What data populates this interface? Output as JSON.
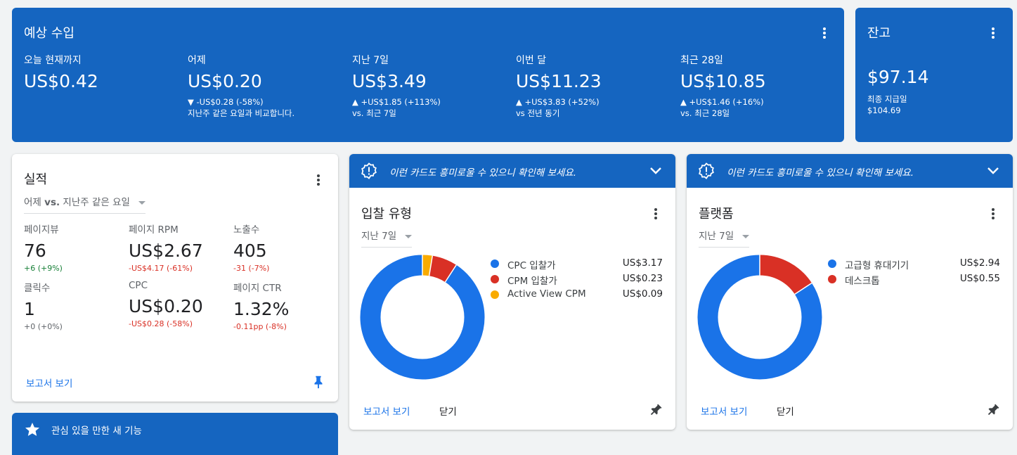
{
  "estimated": {
    "title": "예상 수입",
    "metrics": [
      {
        "label": "오늘 현재까지",
        "value": "US$0.42",
        "change": "",
        "note": ""
      },
      {
        "label": "어제",
        "value": "US$0.20",
        "change": "▼ -US$0.28 (-58%)",
        "note": "지난주 같은 요일과 비교합니다."
      },
      {
        "label": "지난 7일",
        "value": "US$3.49",
        "change": "▲ +US$1.85 (+113%)",
        "note": "vs. 최근 7일"
      },
      {
        "label": "이번 달",
        "value": "US$11.23",
        "change": "▲ +US$3.83 (+52%)",
        "note": "vs 전년 동기"
      },
      {
        "label": "최근 28일",
        "value": "US$10.85",
        "change": "▲ +US$1.46 (+16%)",
        "note": "vs. 최근 28일"
      }
    ]
  },
  "balance": {
    "title": "잔고",
    "value": "$97.14",
    "last_payment_label": "최종 지급일",
    "last_payment_value": "$104.69"
  },
  "performance": {
    "title": "실적",
    "dropdown_value": "어제",
    "dropdown_bold": "vs.",
    "dropdown_rest": "지난주 같은 요일",
    "metrics": [
      {
        "label": "페이지뷰",
        "value": "76",
        "change": "+6 (+9%)",
        "tone": "pos"
      },
      {
        "label": "페이지 RPM",
        "value": "US$2.67",
        "change": "-US$4.17 (-61%)",
        "tone": "neg"
      },
      {
        "label": "노출수",
        "value": "405",
        "change": "-31 (-7%)",
        "tone": "neg"
      },
      {
        "label": "클릭수",
        "value": "1",
        "change": "+0 (+0%)",
        "tone": "neu"
      },
      {
        "label": "CPC",
        "value": "US$0.20",
        "change": "-US$0.28 (-58%)",
        "tone": "neg"
      },
      {
        "label": "페이지 CTR",
        "value": "1.32%",
        "change": "-0.11pp (-8%)",
        "tone": "neg"
      }
    ],
    "report_link": "보고서 보기"
  },
  "bid_type": {
    "banner_text": "이런 카드도 흥미로울 수 있으니 확인해 보세요.",
    "title": "입찰 유형",
    "dropdown_value": "지난 7일",
    "items": [
      {
        "name": "CPC 입찰가",
        "amount": "US$3.17",
        "value": 3.17,
        "color": "#1a73e8"
      },
      {
        "name": "CPM 입찰가",
        "amount": "US$0.23",
        "value": 0.23,
        "color": "#d93025"
      },
      {
        "name": "Active View CPM",
        "amount": "US$0.09",
        "value": 0.09,
        "color": "#f9ab00"
      }
    ],
    "report_link": "보고서 보기",
    "close_label": "닫기"
  },
  "platform": {
    "banner_text": "이런 카드도 흥미로울 수 있으니 확인해 보세요.",
    "title": "플랫폼",
    "dropdown_value": "지난 7일",
    "items": [
      {
        "name": "고급형 휴대기기",
        "amount": "US$2.94",
        "value": 2.94,
        "color": "#1a73e8"
      },
      {
        "name": "데스크톱",
        "amount": "US$0.55",
        "value": 0.55,
        "color": "#d93025"
      }
    ],
    "report_link": "보고서 보기",
    "close_label": "닫기"
  },
  "new_features": {
    "title": "관심 있을 만한 새 기능"
  }
}
